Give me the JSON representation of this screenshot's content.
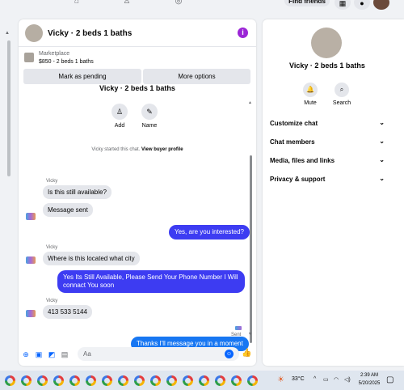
{
  "topnav": {
    "find_friends": "Find friends"
  },
  "chat": {
    "title": "Vicky · 2 beds 1 baths",
    "info_icon": "i",
    "marketplace_label": "Marketplace",
    "listing": "$850 - 2 beds 1 baths",
    "mark_pending": "Mark as pending",
    "more_options": "More options",
    "scrolled_title": "Vicky · 2 beds 1 baths",
    "add_label": "Add",
    "name_label": "Name",
    "started_text": "Vicky started this chat.",
    "view_profile": "View buyer profile",
    "messages": [
      {
        "sender": "Vicky",
        "text": "Is this still available?"
      },
      {
        "text": "Message sent"
      },
      {
        "text": "Yes, are you interested?"
      },
      {
        "sender": "Vicky",
        "text": "Where is this located what city"
      },
      {
        "line1": "Yes Its Still Available, Please Send Your Phone Number I Will",
        "line2": "connact You soon"
      },
      {
        "sender": "Vicky",
        "text": "413 533 5144"
      },
      {
        "text": "Thanks I'll message you in a moment"
      }
    ],
    "sent_label": "Sent",
    "composer_placeholder": "Aa"
  },
  "right_panel": {
    "title": "Vicky · 2 beds 1 baths",
    "mute": "Mute",
    "search": "Search",
    "items": [
      "Customize chat",
      "Chat members",
      "Media, files and links",
      "Privacy & support"
    ]
  },
  "taskbar": {
    "temp": "33°C",
    "time": "2:39 AM",
    "date": "5/20/2025"
  }
}
